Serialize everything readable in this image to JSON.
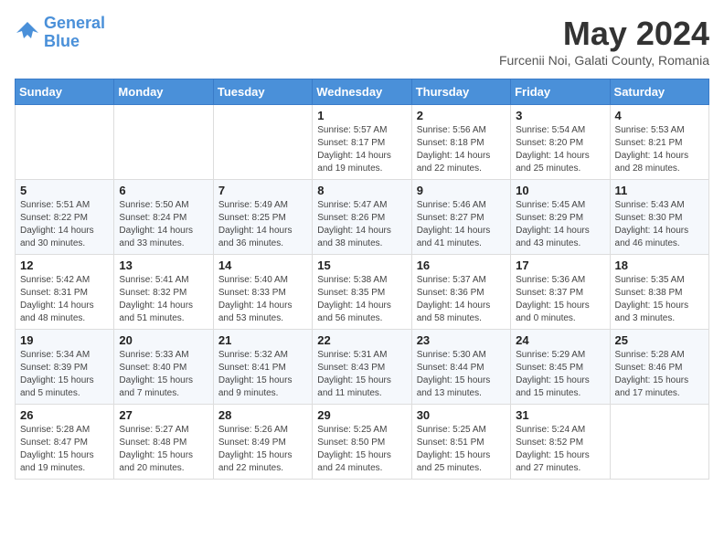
{
  "header": {
    "logo_line1": "General",
    "logo_line2": "Blue",
    "month_title": "May 2024",
    "location": "Furcenii Noi, Galati County, Romania"
  },
  "days_of_week": [
    "Sunday",
    "Monday",
    "Tuesday",
    "Wednesday",
    "Thursday",
    "Friday",
    "Saturday"
  ],
  "weeks": [
    [
      {
        "day": "",
        "info": ""
      },
      {
        "day": "",
        "info": ""
      },
      {
        "day": "",
        "info": ""
      },
      {
        "day": "1",
        "info": "Sunrise: 5:57 AM\nSunset: 8:17 PM\nDaylight: 14 hours\nand 19 minutes."
      },
      {
        "day": "2",
        "info": "Sunrise: 5:56 AM\nSunset: 8:18 PM\nDaylight: 14 hours\nand 22 minutes."
      },
      {
        "day": "3",
        "info": "Sunrise: 5:54 AM\nSunset: 8:20 PM\nDaylight: 14 hours\nand 25 minutes."
      },
      {
        "day": "4",
        "info": "Sunrise: 5:53 AM\nSunset: 8:21 PM\nDaylight: 14 hours\nand 28 minutes."
      }
    ],
    [
      {
        "day": "5",
        "info": "Sunrise: 5:51 AM\nSunset: 8:22 PM\nDaylight: 14 hours\nand 30 minutes."
      },
      {
        "day": "6",
        "info": "Sunrise: 5:50 AM\nSunset: 8:24 PM\nDaylight: 14 hours\nand 33 minutes."
      },
      {
        "day": "7",
        "info": "Sunrise: 5:49 AM\nSunset: 8:25 PM\nDaylight: 14 hours\nand 36 minutes."
      },
      {
        "day": "8",
        "info": "Sunrise: 5:47 AM\nSunset: 8:26 PM\nDaylight: 14 hours\nand 38 minutes."
      },
      {
        "day": "9",
        "info": "Sunrise: 5:46 AM\nSunset: 8:27 PM\nDaylight: 14 hours\nand 41 minutes."
      },
      {
        "day": "10",
        "info": "Sunrise: 5:45 AM\nSunset: 8:29 PM\nDaylight: 14 hours\nand 43 minutes."
      },
      {
        "day": "11",
        "info": "Sunrise: 5:43 AM\nSunset: 8:30 PM\nDaylight: 14 hours\nand 46 minutes."
      }
    ],
    [
      {
        "day": "12",
        "info": "Sunrise: 5:42 AM\nSunset: 8:31 PM\nDaylight: 14 hours\nand 48 minutes."
      },
      {
        "day": "13",
        "info": "Sunrise: 5:41 AM\nSunset: 8:32 PM\nDaylight: 14 hours\nand 51 minutes."
      },
      {
        "day": "14",
        "info": "Sunrise: 5:40 AM\nSunset: 8:33 PM\nDaylight: 14 hours\nand 53 minutes."
      },
      {
        "day": "15",
        "info": "Sunrise: 5:38 AM\nSunset: 8:35 PM\nDaylight: 14 hours\nand 56 minutes."
      },
      {
        "day": "16",
        "info": "Sunrise: 5:37 AM\nSunset: 8:36 PM\nDaylight: 14 hours\nand 58 minutes."
      },
      {
        "day": "17",
        "info": "Sunrise: 5:36 AM\nSunset: 8:37 PM\nDaylight: 15 hours\nand 0 minutes."
      },
      {
        "day": "18",
        "info": "Sunrise: 5:35 AM\nSunset: 8:38 PM\nDaylight: 15 hours\nand 3 minutes."
      }
    ],
    [
      {
        "day": "19",
        "info": "Sunrise: 5:34 AM\nSunset: 8:39 PM\nDaylight: 15 hours\nand 5 minutes."
      },
      {
        "day": "20",
        "info": "Sunrise: 5:33 AM\nSunset: 8:40 PM\nDaylight: 15 hours\nand 7 minutes."
      },
      {
        "day": "21",
        "info": "Sunrise: 5:32 AM\nSunset: 8:41 PM\nDaylight: 15 hours\nand 9 minutes."
      },
      {
        "day": "22",
        "info": "Sunrise: 5:31 AM\nSunset: 8:43 PM\nDaylight: 15 hours\nand 11 minutes."
      },
      {
        "day": "23",
        "info": "Sunrise: 5:30 AM\nSunset: 8:44 PM\nDaylight: 15 hours\nand 13 minutes."
      },
      {
        "day": "24",
        "info": "Sunrise: 5:29 AM\nSunset: 8:45 PM\nDaylight: 15 hours\nand 15 minutes."
      },
      {
        "day": "25",
        "info": "Sunrise: 5:28 AM\nSunset: 8:46 PM\nDaylight: 15 hours\nand 17 minutes."
      }
    ],
    [
      {
        "day": "26",
        "info": "Sunrise: 5:28 AM\nSunset: 8:47 PM\nDaylight: 15 hours\nand 19 minutes."
      },
      {
        "day": "27",
        "info": "Sunrise: 5:27 AM\nSunset: 8:48 PM\nDaylight: 15 hours\nand 20 minutes."
      },
      {
        "day": "28",
        "info": "Sunrise: 5:26 AM\nSunset: 8:49 PM\nDaylight: 15 hours\nand 22 minutes."
      },
      {
        "day": "29",
        "info": "Sunrise: 5:25 AM\nSunset: 8:50 PM\nDaylight: 15 hours\nand 24 minutes."
      },
      {
        "day": "30",
        "info": "Sunrise: 5:25 AM\nSunset: 8:51 PM\nDaylight: 15 hours\nand 25 minutes."
      },
      {
        "day": "31",
        "info": "Sunrise: 5:24 AM\nSunset: 8:52 PM\nDaylight: 15 hours\nand 27 minutes."
      },
      {
        "day": "",
        "info": ""
      }
    ]
  ]
}
